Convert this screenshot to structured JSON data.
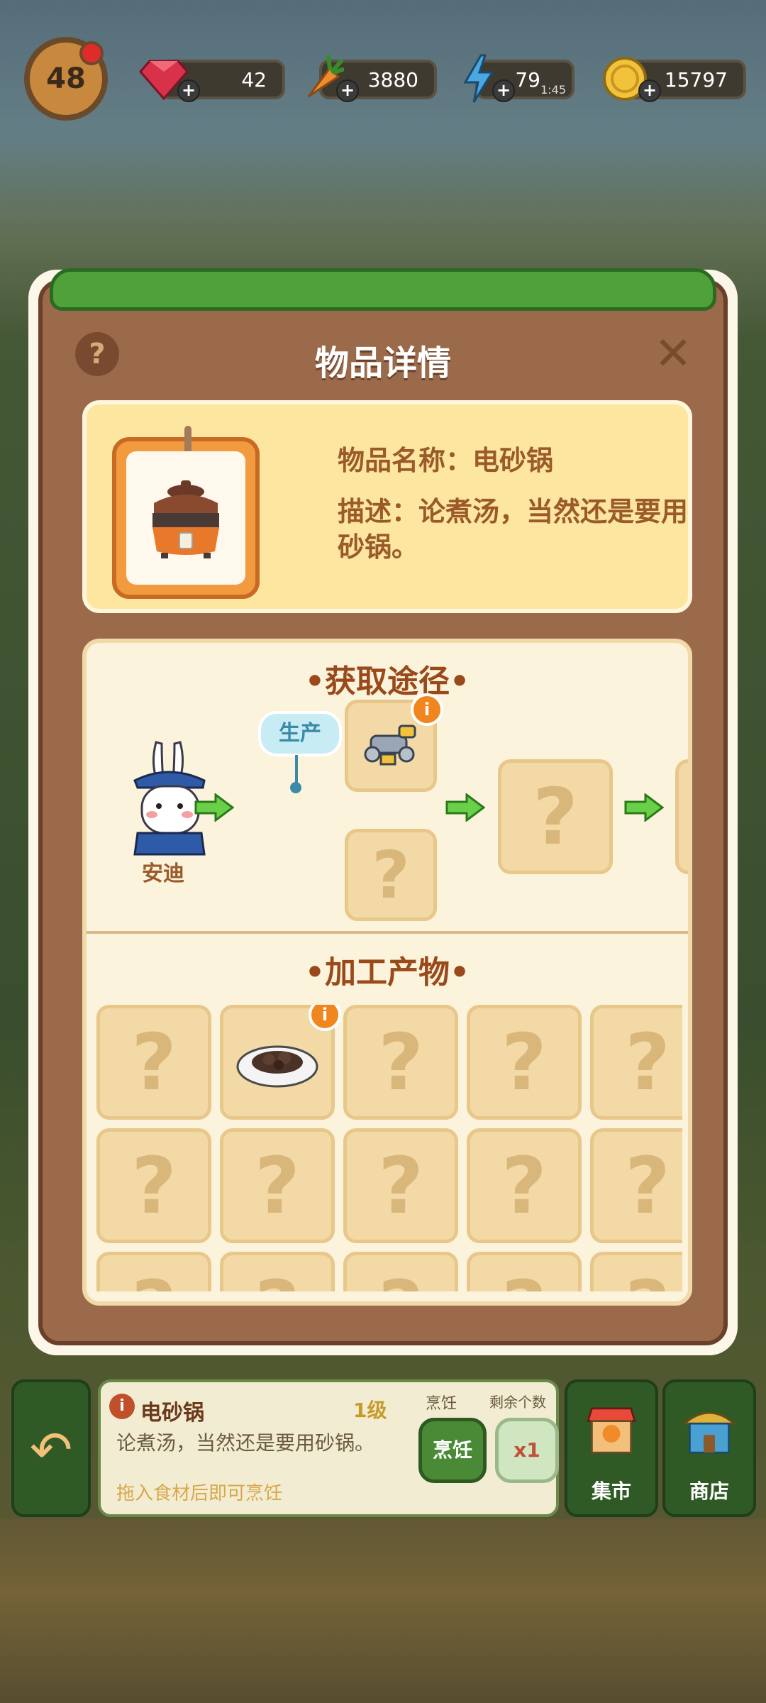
{
  "topbar": {
    "level": "48",
    "gems": "42",
    "carrots": "3880",
    "energy": "79",
    "energy_timer": "1:45",
    "coins": "15797"
  },
  "popup": {
    "title": "物品详情",
    "item_name_line": "物品名称：电砂锅",
    "item_desc_line": "描述：论煮汤，当然还是要用砂锅。",
    "obtain_title": "•获取途径•",
    "produce_tag": "生产",
    "character_name": "安迪",
    "unknown_mark": "?",
    "info_badge": "i",
    "products_title": "•加工产物•"
  },
  "bottom": {
    "item_name": "电砂锅",
    "item_level": "1级",
    "desc": "论煮汤，当然还是要用砂锅。",
    "hint": "拖入食材后即可烹饪",
    "cook_label": "烹饪",
    "remain_label": "剩余个数",
    "cook_button": "烹饪",
    "count": "x1",
    "market_label": "集市",
    "shop_label": "商店"
  },
  "colors": {
    "panel_brown": "#9b6a4a",
    "cream": "#fbf3dc",
    "slot": "#f3d9a6",
    "accent_orange": "#f2861e",
    "green_btn": "#4a8a36"
  },
  "icons": {
    "level": "carrot-badge-icon",
    "gems": "gem-icon",
    "carrots": "carrot-icon",
    "energy": "lightning-icon",
    "coins": "coin-icon",
    "help": "question-icon",
    "close": "close-icon",
    "back": "back-arrow-icon",
    "market": "market-stall-icon",
    "shop": "shop-icon"
  }
}
